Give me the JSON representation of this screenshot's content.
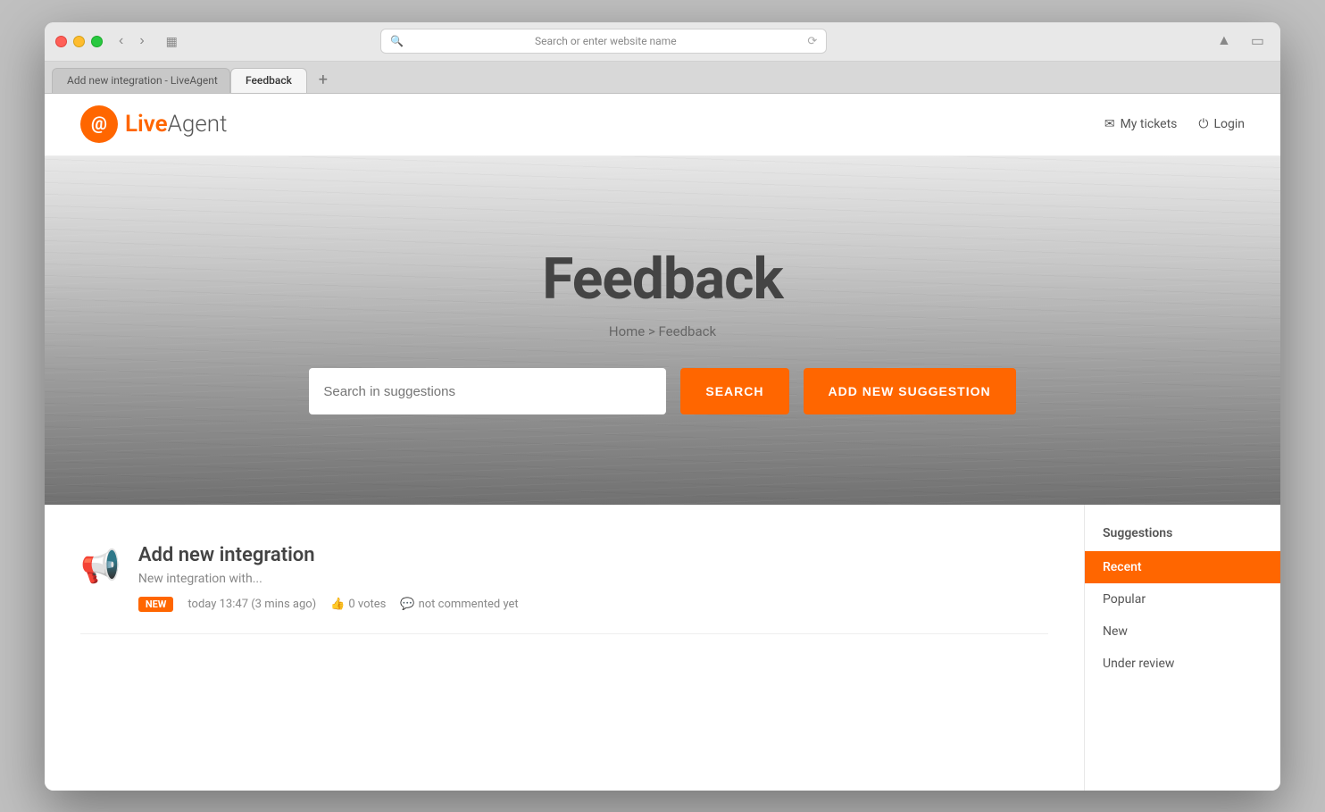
{
  "browser": {
    "address_bar_text": "Search or enter website name",
    "tab1_label": "Add new integration - LiveAgent",
    "tab2_label": "Feedback",
    "add_tab_label": "+"
  },
  "header": {
    "logo_live": "Live",
    "logo_agent": "Agent",
    "nav_tickets": "My tickets",
    "nav_login": "Login"
  },
  "hero": {
    "title": "Feedback",
    "breadcrumb": "Home > Feedback",
    "search_placeholder": "Search in suggestions",
    "search_btn_label": "SEARCH",
    "add_suggestion_btn_label": "ADD NEW SUGGESTION"
  },
  "suggestions": {
    "sidebar_title": "Suggestions",
    "filters": [
      {
        "label": "Recent",
        "active": true
      },
      {
        "label": "Popular",
        "active": false
      },
      {
        "label": "New",
        "active": false
      },
      {
        "label": "Under review",
        "active": false
      }
    ],
    "items": [
      {
        "title": "Add new integration",
        "description": "New integration with...",
        "badge": "New",
        "timestamp": "today 13:47 (3 mins ago)",
        "votes": "0 votes",
        "comments": "not commented yet"
      }
    ]
  }
}
